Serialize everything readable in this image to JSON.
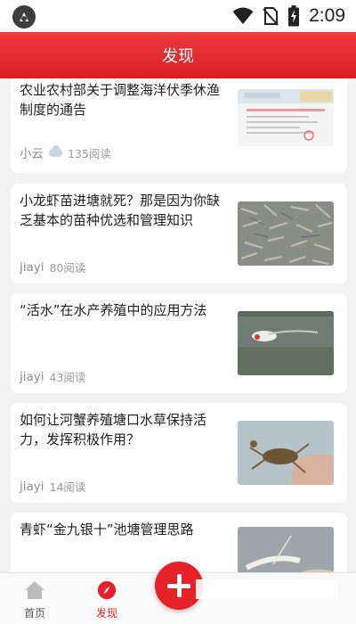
{
  "status_bar": {
    "time": "2:09",
    "icons": [
      "app-icon",
      "wifi-icon",
      "no-sim-icon",
      "battery-charging-icon"
    ]
  },
  "header": {
    "title": "发现"
  },
  "articles": [
    {
      "title": "农业农村部关于调整海洋伏季休渔制度的通告",
      "author": "小云",
      "author_badge": "cloud-icon",
      "reads": "135阅读",
      "thumb": "document-thumbnail"
    },
    {
      "title": "小龙虾苗进塘就死？那是因为你缺乏基本的苗种优选和管理知识",
      "author": "jiayi",
      "reads": "80阅读",
      "thumb": "crayfish-thumbnail"
    },
    {
      "title": "“活水”在水产养殖中的应用方法",
      "author": "jiayi",
      "reads": "43阅读",
      "thumb": "aerator-pond-thumbnail"
    },
    {
      "title": "如何让河蟹养殖塘口水草保持活力，发挥积极作用？",
      "author": "jiayi",
      "reads": "14阅读",
      "thumb": "crab-hand-thumbnail"
    },
    {
      "title": "青虾“金九银十”池塘管理思路",
      "thumb": "shrimp-thumbnail"
    }
  ],
  "bottom_nav": {
    "tabs": [
      {
        "label": "首页",
        "icon": "home-icon"
      },
      {
        "label": "发现",
        "icon": "compass-icon",
        "active": true
      }
    ],
    "fab_icon": "plus-icon"
  },
  "colors": {
    "accent": "#e62129",
    "title_bar": "#e3262d",
    "background": "#f2f2f2"
  }
}
